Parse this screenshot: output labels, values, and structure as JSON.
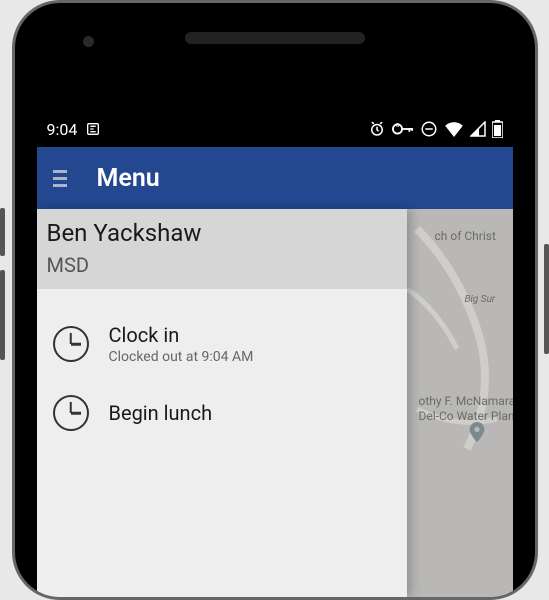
{
  "status_bar": {
    "time": "9:04",
    "icons": {
      "app_notif": "app-notif-icon",
      "alarm": "alarm-icon",
      "vpn": "vpn-key-icon",
      "dnd": "dnd-icon",
      "wifi": "wifi-icon",
      "signal": "signal-icon",
      "battery": "battery-icon"
    }
  },
  "app_bar": {
    "title": "Menu"
  },
  "drawer": {
    "user_name": "Ben Yackshaw",
    "user_org": "MSD",
    "items": [
      {
        "title": "Clock in",
        "subtitle": "Clocked out at 9:04 AM",
        "icon": "clock-icon"
      },
      {
        "title": "Begin lunch",
        "subtitle": "",
        "icon": "clock-icon"
      }
    ]
  },
  "map": {
    "labels": [
      "ch of Christ",
      "Big Sur",
      "othy F. McNamara",
      "Del-Co Water Plant"
    ]
  }
}
